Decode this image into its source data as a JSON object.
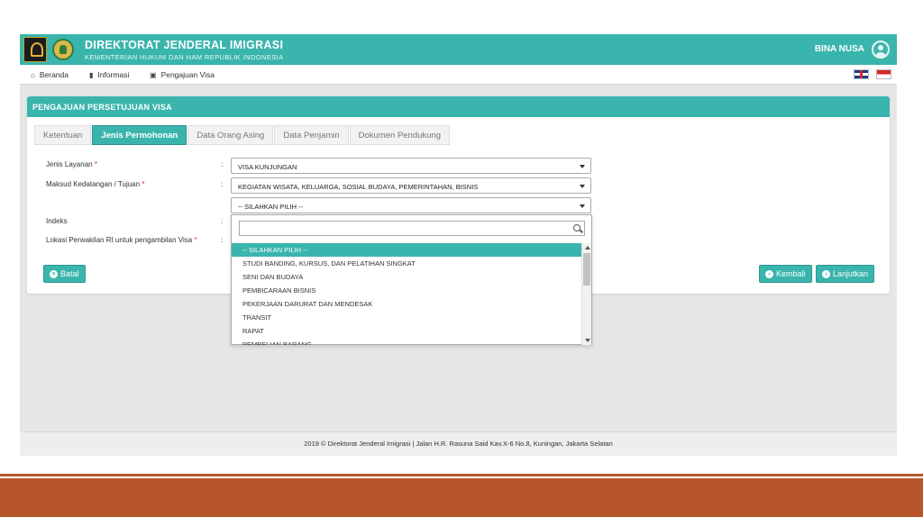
{
  "header": {
    "title": "DIREKTORAT JENDERAL IMIGRASI",
    "subtitle": "KEMENTERIAN HUKUM DAN HAM REPUBLIK INDONESIA",
    "user_name": "BINA NUSA"
  },
  "nav": {
    "items": [
      {
        "label": "Beranda",
        "icon": "home-icon"
      },
      {
        "label": "Informasi",
        "icon": "book-icon"
      },
      {
        "label": "Pengajuan Visa",
        "icon": "id-card-icon"
      }
    ],
    "languages": [
      "English",
      "Indonesia"
    ]
  },
  "panel": {
    "title": "PENGAJUAN PERSETUJUAN VISA",
    "tabs": [
      {
        "label": "Ketentuan",
        "active": false
      },
      {
        "label": "Jenis Permohonan",
        "active": true
      },
      {
        "label": "Data Orang Asing",
        "active": false
      },
      {
        "label": "Data Penjamin",
        "active": false
      },
      {
        "label": "Dokumen Pendukung",
        "active": false
      }
    ]
  },
  "form": {
    "jenis_layanan": {
      "label": "Jenis Layanan",
      "required": "*",
      "value": "VISA KUNJUNGAN"
    },
    "maksud": {
      "label": "Maksud Kedatangan / Tujuan",
      "required": "*",
      "value": "KEGIATAN WISATA, KELUARGA, SOSIAL BUDAYA, PEMERINTAHAN, BISNIS"
    },
    "sub_maksud": {
      "value": "-- SILAHKAN PILIH --"
    },
    "indeks": {
      "label": "Indeks"
    },
    "lokasi": {
      "label": "Lokasi Perwakilan RI untuk pengambilan Visa",
      "required": "*"
    },
    "colon": ":"
  },
  "dropdown": {
    "search_value": "",
    "options": [
      "-- SILAHKAN PILIH --",
      "STUDI BANDING, KURSUS, DAN PELATIHAN SINGKAT",
      "SENI DAN BUDAYA",
      "PEMBICARAAN BISNIS",
      "PEKERJAAN DARURAT DAN MENDESAK",
      "TRANSIT",
      "RAPAT",
      "PEMBELIAN BARANG"
    ],
    "highlighted_index": 0
  },
  "buttons": {
    "batal": "Batal",
    "kembali": "Kembali",
    "lanjutkan": "Lanjutkan"
  },
  "footer": {
    "text": "2019 © Direktorat Jenderal Imigrasi | Jalan H.R. Rasuna Said Kav.X-6 No.8, Kuningan, Jakarta Selatan"
  },
  "colors": {
    "accent": "#3ab5ad",
    "slide_band": "#b8552b"
  }
}
